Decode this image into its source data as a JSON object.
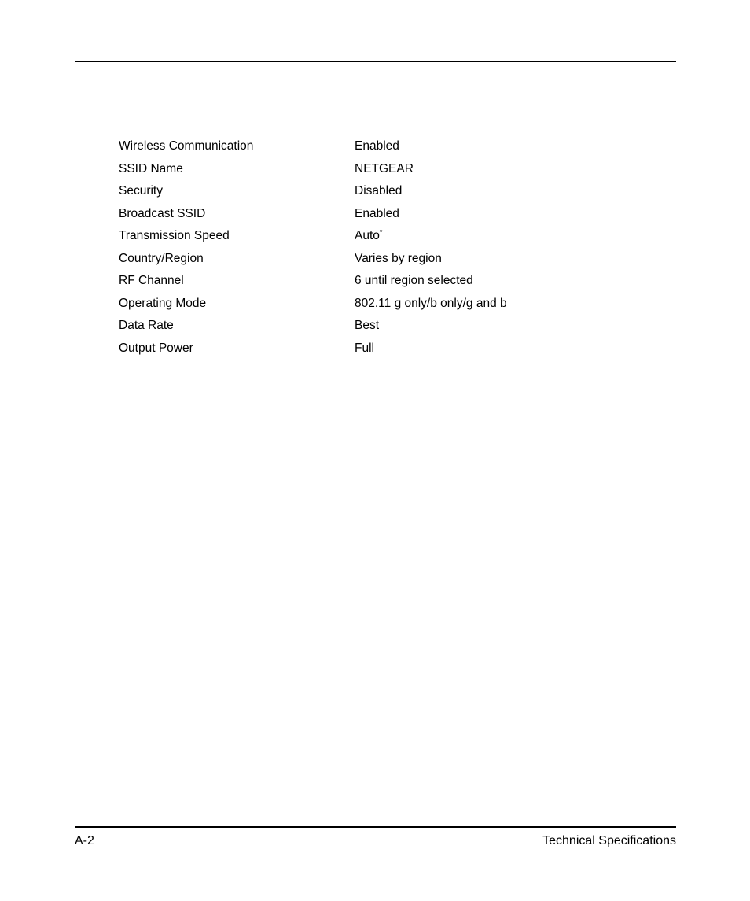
{
  "document": {
    "page_label": "A-2",
    "section_title": "Technical Specifications"
  },
  "spec_table": {
    "rows": [
      {
        "label": "Wireless Communication",
        "value": "Enabled",
        "footnote": ""
      },
      {
        "label": "SSID Name",
        "value": "NETGEAR",
        "footnote": ""
      },
      {
        "label": "Security",
        "value": "Disabled",
        "footnote": ""
      },
      {
        "label": "Broadcast SSID",
        "value": "Enabled",
        "footnote": ""
      },
      {
        "label": "Transmission Speed",
        "value": "Auto",
        "footnote": "*"
      },
      {
        "label": "Country/Region",
        "value": "Varies by region",
        "footnote": ""
      },
      {
        "label": "RF Channel",
        "value": "6 until region selected",
        "footnote": ""
      },
      {
        "label": "Operating Mode",
        "value": "802.11 g only/b only/g and b",
        "footnote": ""
      },
      {
        "label": "Data Rate",
        "value": "Best",
        "footnote": ""
      },
      {
        "label": "Output Power",
        "value": "Full",
        "footnote": ""
      }
    ]
  },
  "colors": {
    "text": "#000000",
    "background": "#ffffff",
    "rule": "#000000"
  }
}
